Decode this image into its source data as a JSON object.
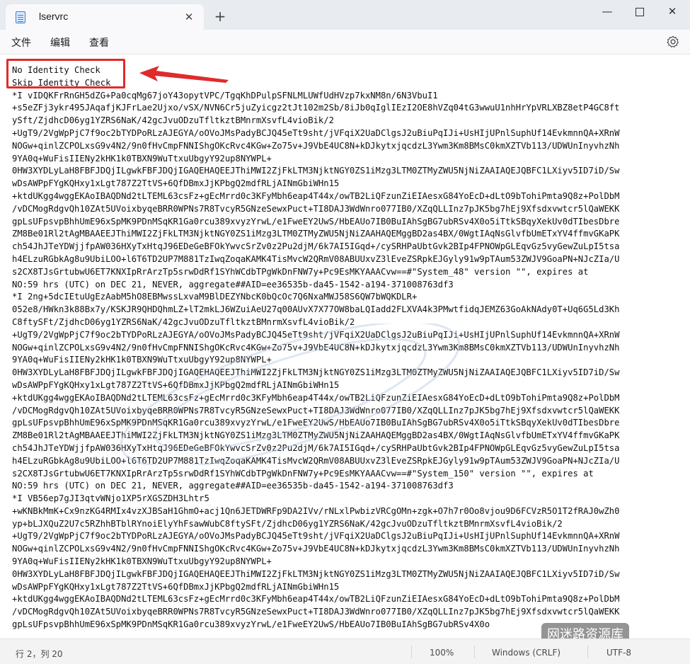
{
  "window": {
    "tab_title": "lservrc",
    "tab_close_glyph": "✕",
    "new_tab_glyph": "+",
    "minimize_glyph": "—",
    "close_glyph": "✕"
  },
  "menubar": {
    "file": "文件",
    "edit": "编辑",
    "view": "查看"
  },
  "editor": {
    "lines": [
      "No Identity Check",
      "Skip Identity Check",
      "*I vIDQKFrRnGH5dZG+Pa0cqMg67joY43opytVPC/TgqKhDPulpSFNLMLUWfUdHVzp7kxNM8n/6N3VbuI1",
      "+s5eZFj3ykr495JAqafjKJFrLae2Ujxo/vSX/NVN6Cr5juZyicgz2tJt102m2Sb/8iJb0qIglIEzI2OE8hVZq04tG3wwuU1nhHrYpVRLXBZ8etP4GC8ft",
      "ySft/ZjdhcD06yg1YZRS6NaK/42gcJvuODzuTfltkztBMnrmXsvfL4vioBik/2",
      "+UgT9/2VgWpPjC7f9oc2bTYDPoRLzAJEGYA/oOVoJMsPadyBCJQ45eTt9sht/jVFqiX2UaDClgsJ2uBiuPqIJi+UsHIjUPnlSuphUf14EvkmnnQA+XRnW",
      "NOGw+qinlZCPOLxsG9v4N2/9n0fHvCmpFNNIShgOKcRvc4KGw+Zo75v+J9VbE4UC8N+kDJkytxjqcdzL3Ywm3Km8BMsC0kmXZTVb113/UDWUnInyvhzNh",
      "9YA0q+WuFisIIENy2kHK1k0TBXN9WuTtxuUbgyY92up8NYWPL+",
      "0HW3XYDLyLaH8FBFJDQjILgwkFBFJDQjIGAQEHAQEEJThiMWI2ZjFkLTM3NjktNGY0ZS1iMzg3LTM0ZTMyZWU5NjNiZAAIAQEJQBFC1LXiyv5ID7iD/Sw",
      "wDsAWPpFYgKQHxy1xLgt787Z2TtVS+6QfDBmxJjKPbgQ2mdfRLjAINmGbiWHn15",
      "+ktdUKgg4wggEKAoIBAQDNd2tLTEML63csFz+gEcMrrd0c3KFyMbh6eap4T44x/owTB2LiQFzunZiEIAesxG84YoEcD+dLtO9bTohiPmta9Q8z+PolDbM",
      "/vDCMogRdgvQh10ZAt5UVoixbyqeBRR0WPNs7R8TvcyR5GNzeSewxPuct+TI8DAJ3WdWnro077IB0/XZqQLLInz7pJK5bg7hEj9Xfsdxvwtcr5lQaWEKK",
      "gpLsUFpsvpBhhUmE96xSpMK9PDnMSqKR1Ga0rcu389xvyzYrwL/e1FweEY2UwS/HbEAUo7IB0BuIAhSgBG7ubRSv4X0o5iTtkSBqyXekUv0dTIbesDbre",
      "ZM8Be01Rl2tAgMBAAEEJThiMWI2ZjFkLTM3NjktNGY0ZS1iMzg3LTM0ZTMyZWU5NjNiZAAHAQEMggBD2as4BX/0WgtIAqNsGlvfbUmETxYV4ffmvGKaPK",
      "ch54JhJTeYDWjjfpAW036HXyTxHtqJ96EDeGeBFOkYwvcSrZv0z2Pu2djM/6k7AI5IGqd+/cySRHPaUbtGvk2BIp4FPNOWpGLEqvGz5vyGewZuLpI5tsa",
      "h4ELzuRGbkAg8u9UbiLOO+l6T6TD2UP7M881TzIwqZoqaKAMK4TisMvcW2QRmV08ABUUxvZ3lEveZSRpkEJGyly91w9pTAum53ZWJV9GoaPN+NJcZIa/U",
      "s2CX8TJsGrtubwU6ET7KNXIpRrArzTp5srwDdRf1SYhWCdbTPgWkDnFNW7y+Pc9EsMKYAAACvw==#\"System_48\" version \"\", expires at",
      "NO:59 hrs (UTC) on DEC 21, NEVER, aggregate##AID=ee36535b-da45-1542-a194-371008763df3",
      "*I 2ng+5dcIEtuUgEzAabM5hO8EBMwssLxvaM9BlDEZYNbcK0bQcOc7Q6NxaMWJ58S6QW7bWQKDLR+",
      "052e8/HWkn3k88Bx7y/KSKJR9QHDQhmLZ+lT2mkLJ6WZuiAeU27q00AUvX7X77OW8baLQIadd2FLXVA4k3PMwtfidqJEMZ63GoAkNAdy0T+Uq6G5Ld3Kh",
      "C8ftySFt/ZjdhcD06yg1YZRS6NaK/42gcJvuODzuTfltkztBMnrmXsvfL4vioBik/2",
      "+UgT9/2VgWpPjC7f9oc2bTYDPoRLzAJEGYA/oOVoJMsPadyBCJQ45eTt9sht/jVFqiX2UaDClgsJ2uBiuPqIJi+UsHIjUPnlSuphUf14EvkmnnQA+XRnW",
      "NOGw+qinlZCPOLxsG9v4N2/9n0fHvCmpFNNIShgOKcRvc4KGw+Zo75v+J9VbE4UC8N+kDJkytxjqcdzL3Ywm3Km8BMsC0kmXZTVb113/UDWUnInyvhzNh",
      "9YA0q+WuFisIIENy2kHK1k0TBXN9WuTtxuUbgyY92up8NYWPL+",
      "0HW3XYDLyLaH8FBFJDQjILgwkFBFJDQjIGAQEHAQEEJThiMWI2ZjFkLTM3NjktNGY0ZS1iMzg3LTM0ZTMyZWU5NjNiZAAIAQEJQBFC1LXiyv5ID7iD/Sw",
      "wDsAWPpFYgKQHxy1xLgt787Z2TtVS+6QfDBmxJjKPbgQ2mdfRLjAINmGbiWHn15",
      "+ktdUKgg4wggEKAoIBAQDNd2tLTEML63csFz+gEcMrrd0c3KFyMbh6eap4T44x/owTB2LiQFzunZiEIAesxG84YoEcD+dLtO9bTohiPmta9Q8z+PolDbM",
      "/vDCMogRdgvQh10ZAt5UVoixbyqeBRR0WPNs7R8TvcyR5GNzeSewxPuct+TI8DAJ3WdWnro077IB0/XZqQLLInz7pJK5bg7hEj9Xfsdxvwtcr5lQaWEKK",
      "gpLsUFpsvpBhhUmE96xSpMK9PDnMSqKR1Ga0rcu389xvyzYrwL/e1FweEY2UwS/HbEAUo7IB0BuIAhSgBG7ubRSv4X0o5iTtkSBqyXekUv0dTIbesDbre",
      "ZM8Be01Rl2tAgMBAAEEJThiMWI2ZjFkLTM3NjktNGY0ZS1iMzg3LTM0ZTMyZWU5NjNiZAAHAQEMggBD2as4BX/0WgtIAqNsGlvfbUmETxYV4ffmvGKaPK",
      "ch54JhJTeYDWjjfpAW036HXyTxHtqJ96EDeGeBFOkYwvcSrZv0z2Pu2djM/6k7AI5IGqd+/cySRHPaUbtGvk2BIp4FPNOWpGLEqvGz5vyGewZuLpI5tsa",
      "h4ELzuRGbkAg8u9UbiLOO+l6T6TD2UP7M881TzIwqZoqaKAMK4TisMvcW2QRmV08ABUUxvZ3lEveZSRpkEJGyly91w9pTAum53ZWJV9GoaPN+NJcZIa/U",
      "s2CX8TJsGrtubwU6ET7KNXIpRrArzTp5srwDdRf1SYhWCdbTPgWkDnFNW7y+Pc9EsMKYAAACvw==#\"System_150\" version \"\", expires at",
      "NO:59 hrs (UTC) on DEC 21, NEVER, aggregate##AID=ee36535b-da45-1542-a194-371008763df3",
      "*I VB56ep7gJI3qtvWNjo1XP5rXGSZDH3Lhtr5",
      "+wKNBkMmK+Cx9nzKG4RMIx4vzXJBSaH1GhmO+acj1Qn6JETDWRFp9DA2IVv/rNLxlPwbizVRCgOMn+zgk+O7h7r0Oo8vjou9D6FCVzR5O1T2fRAJ0wZh0",
      "yp+bLJXQuZ2U7c5RZhhBTblRYnoiElyYhFsawWubC8ftySFt/ZjdhcD06yg1YZRS6NaK/42gcJvuODzuTfltkztBMnrmXsvfL4vioBik/2",
      "+UgT9/2VgWpPjC7f9oc2bTYDPoRLzAJEGYA/oOVoJMsPadyBCJQ45eTt9sht/jVFqiX2UaDClgsJ2uBiuPqIJi+UsHIjUPnlSuphUf14EvkmnnQA+XRnW",
      "NOGw+qinlZCPOLxsG9v4N2/9n0fHvCmpFNNIShgOKcRvc4KGw+Zo75v+J9VbE4UC8N+kDJkytxjqcdzL3Ywm3Km8BMsC0kmXZTVb113/UDWUnInyvhzNh",
      "9YA0q+WuFisIIENy2kHK1k0TBXN9WuTtxuUbgyY92up8NYWPL+",
      "0HW3XYDLyLaH8FBFJDQjILgwkFBFJDQjIGAQEHAQEEJThiMWI2ZjFkLTM3NjktNGY0ZS1iMzg3LTM0ZTMyZWU5NjNiZAAIAQEJQBFC1LXiyv5ID7iD/Sw",
      "wDsAWPpFYgKQHxy1xLgt787Z2TtVS+6QfDBmxJjKPbgQ2mdfRLjAINmGbiWHn15",
      "+ktdUKgg4wggEKAoIBAQDNd2tLTEML63csFz+gEcMrrd0c3KFyMbh6eap4T44x/owTB2LiQFzunZiEIAesxG84YoEcD+dLtO9bTohiPmta9Q8z+PolDbM",
      "/vDCMogRdgvQh10ZAt5UVoixbyqeBRR0WPNs7R8TvcyR5GNzeSewxPuct+TI8DAJ3WdWnro077IB0/XZqQLLInz7pJK5bg7hEj9Xfsdxvwtcr5lQaWEKK",
      "gpLsUFpsvpBhhUmE96xSpMK9PDnMSqKR1Ga0rcu389xvyzYrwL/e1FweEY2UwS/HbEAUo7IB0BuIAhSgBG7ubRSv4X0o"
    ]
  },
  "watermark_source": "网迷路资源库",
  "statusbar": {
    "position": "行 2，列 20",
    "zoom": "100%",
    "line_ending": "Windows (CRLF)",
    "encoding": "UTF-8"
  },
  "colors": {
    "annotation_red": "#e02b2b",
    "titlebar_bg": "#e8ebf0",
    "statusbar_bg": "#f3f3f3"
  }
}
